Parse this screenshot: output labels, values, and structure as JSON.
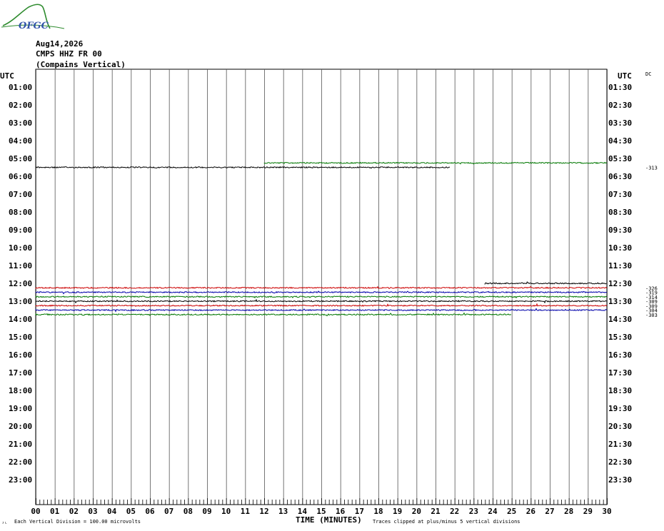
{
  "header": {
    "logo_text": "OFGC",
    "date": "Aug14,2026",
    "station": "CMPS HHZ FR 00",
    "location": "(Compains Vertical)"
  },
  "axis": {
    "left_title": "UTC",
    "right_title": "UTC",
    "dc_label": "DC",
    "x_title": "TIME (MINUTES)",
    "footnote_left": "Each Vertical Division =  100.00 microvolts",
    "footnote_right": "Traces clipped at plus/minus 5 vertical divisions",
    "corner_mark": "ᴶᴸ"
  },
  "chart_data": {
    "type": "line",
    "title": "",
    "x_range": [
      0,
      30
    ],
    "x_ticks": [
      "00",
      "01",
      "02",
      "03",
      "04",
      "05",
      "06",
      "07",
      "08",
      "09",
      "10",
      "11",
      "12",
      "13",
      "14",
      "15",
      "16",
      "17",
      "18",
      "19",
      "20",
      "21",
      "22",
      "23",
      "24",
      "25",
      "26",
      "27",
      "28",
      "29",
      "30"
    ],
    "left_rows": [
      "",
      "01:00",
      "02:00",
      "03:00",
      "04:00",
      "05:00",
      "06:00",
      "07:00",
      "08:00",
      "09:00",
      "10:00",
      "11:00",
      "12:00",
      "13:00",
      "14:00",
      "15:00",
      "16:00",
      "17:00",
      "18:00",
      "19:00",
      "20:00",
      "21:00",
      "22:00",
      "23:00"
    ],
    "right_rows": [
      "",
      "01:30",
      "02:30",
      "03:30",
      "04:30",
      "05:30",
      "06:30",
      "07:30",
      "08:30",
      "09:30",
      "10:30",
      "11:30",
      "12:30",
      "13:30",
      "14:30",
      "15:30",
      "16:30",
      "17:30",
      "18:30",
      "19:30",
      "20:30",
      "21:30",
      "22:30",
      "23:30"
    ],
    "traces": [
      {
        "row": 10.5,
        "color": "#007700",
        "x_start": 12.0,
        "x_end": 30.0,
        "dc": ""
      },
      {
        "row": 11.0,
        "color": "#000000",
        "x_start": 0.0,
        "x_end": 21.75,
        "dc": "-313"
      },
      {
        "row": 24.0,
        "color": "#000000",
        "x_start": 23.6,
        "x_end": 30.0,
        "dc": ""
      },
      {
        "row": 24.5,
        "color": "#cc0000",
        "x_start": 0.0,
        "x_end": 30.0,
        "dc": "-326"
      },
      {
        "row": 25.0,
        "color": "#0000aa",
        "x_start": 0.0,
        "x_end": 30.0,
        "dc": "-319"
      },
      {
        "row": 25.5,
        "color": "#007700",
        "x_start": 0.0,
        "x_end": 30.0,
        "dc": "-314"
      },
      {
        "row": 26.0,
        "color": "#000000",
        "x_start": 0.0,
        "x_end": 30.0,
        "dc": "-309"
      },
      {
        "row": 26.5,
        "color": "#cc0000",
        "x_start": 0.0,
        "x_end": 30.0,
        "dc": "-309"
      },
      {
        "row": 27.0,
        "color": "#0000aa",
        "x_start": 0.0,
        "x_end": 30.0,
        "dc": "-304"
      },
      {
        "row": 27.5,
        "color": "#007700",
        "x_start": 0.0,
        "x_end": 25.0,
        "dc": "-303"
      }
    ]
  }
}
